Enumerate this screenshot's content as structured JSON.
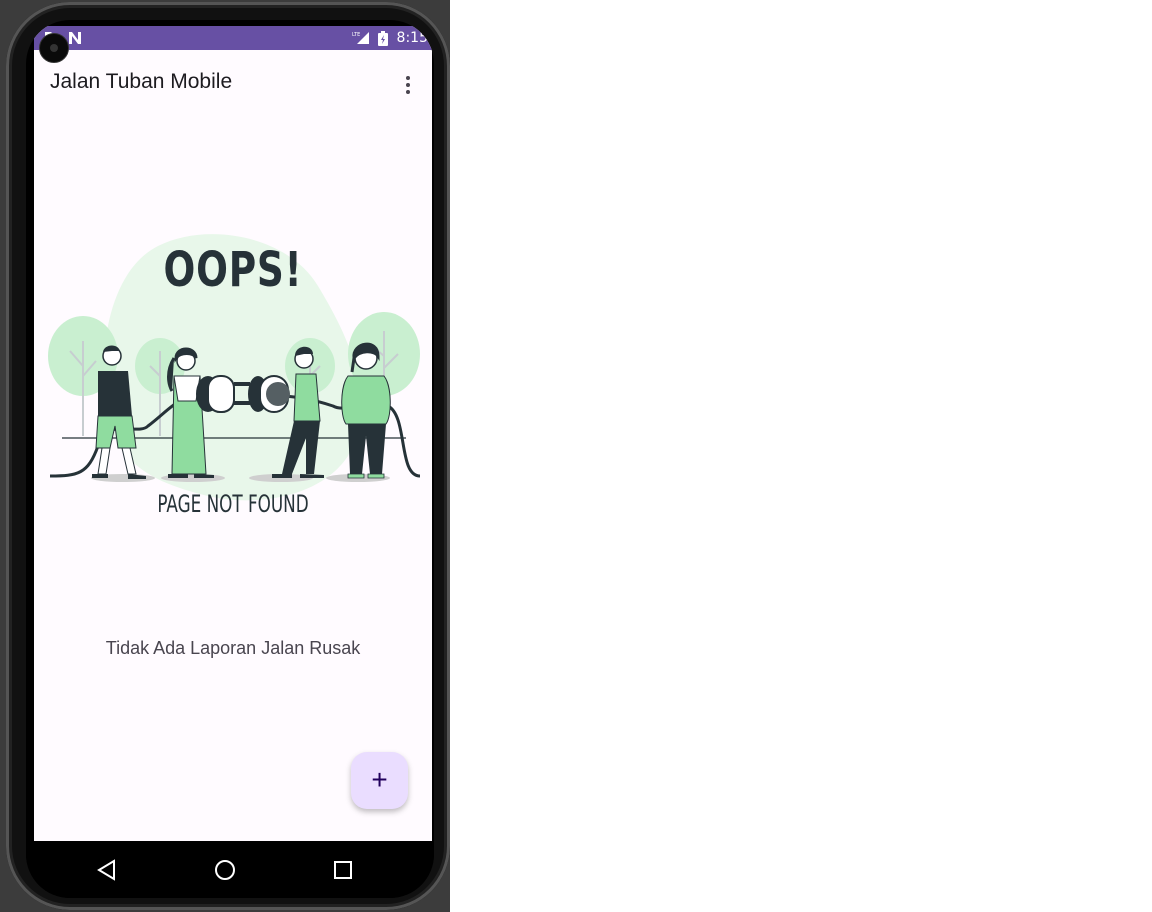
{
  "status_bar": {
    "time": "8:15",
    "icons": [
      "sim-card-icon",
      "notification-n-icon",
      "lte-signal-icon",
      "battery-charging-icon"
    ],
    "lte_label": "LTE"
  },
  "app_bar": {
    "title": "Jalan Tuban Mobile",
    "menu_icon": "more-vert-icon"
  },
  "empty_state": {
    "heading": "OOPS!",
    "subheading": "PAGE NOT FOUND",
    "message": "Tidak Ada Laporan Jalan Rusak"
  },
  "fab": {
    "label": "+",
    "icon": "add-icon"
  },
  "nav_bar": {
    "icons": [
      "back-icon",
      "home-icon",
      "recents-icon"
    ]
  },
  "colors": {
    "status_bar": "#6750a4",
    "background": "#fffbff",
    "fab": "#eaddff",
    "fab_icon": "#21005d",
    "illustration_green": "#8fdc9f",
    "illustration_light": "#e8f7ea",
    "illustration_dark": "#263238"
  }
}
